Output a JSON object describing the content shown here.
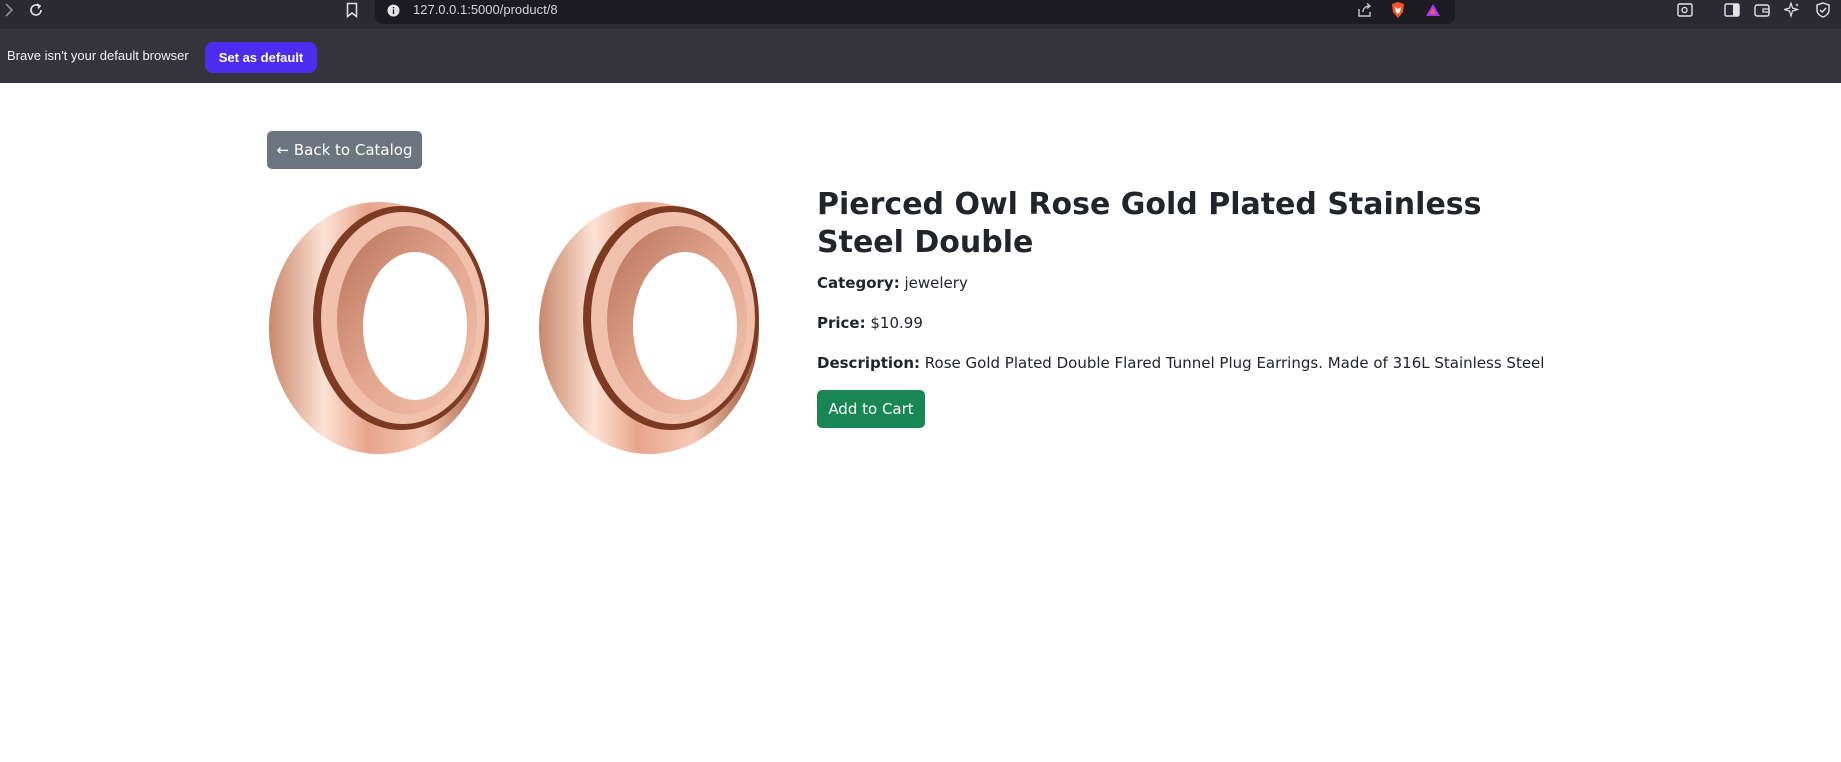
{
  "browser": {
    "url": "127.0.0.1:5000/product/8",
    "infobar_message": "Brave isn't your default browser",
    "set_default_label": "Set as default"
  },
  "page": {
    "back_label": "← Back to Catalog",
    "product": {
      "title": "Pierced Owl Rose Gold Plated Stainless Steel Double",
      "category_label": "Category:",
      "category": "jewelery",
      "price_label": "Price:",
      "price": "$10.99",
      "description_label": "Description:",
      "description": "Rose Gold Plated Double Flared Tunnel Plug Earrings. Made of 316L Stainless Steel",
      "image_icon": "rose-gold-tunnel-plugs-image"
    },
    "add_to_cart_label": "Add to Cart"
  },
  "colors": {
    "chrome_dark": "#2b2a33",
    "infobar": "#35343b",
    "brave_accent": "#4c2df0",
    "back_button": "#6c757d",
    "add_to_cart": "#198754",
    "text": "#212529"
  }
}
